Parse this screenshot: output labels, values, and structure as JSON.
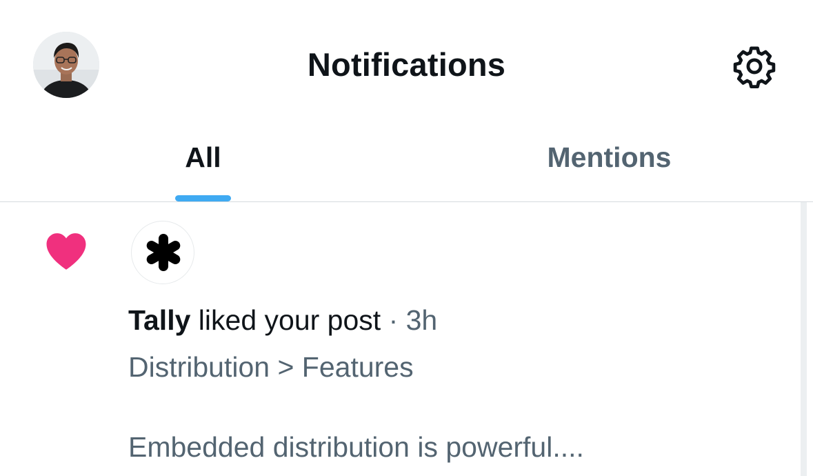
{
  "header": {
    "title": "Notifications",
    "avatar_icon": "profile-avatar",
    "settings_icon": "gear-icon"
  },
  "tabs": [
    {
      "label": "All",
      "selected": true
    },
    {
      "label": "Mentions",
      "selected": false
    }
  ],
  "colors": {
    "accent": "#1d9bf0",
    "like": "#f0307e",
    "text_primary": "#0f1419",
    "text_secondary": "#536471"
  },
  "notifications": [
    {
      "type_icon": "heart-icon",
      "actor_avatar_icon": "asterisk-icon",
      "actor": "Tally",
      "action": "liked your post",
      "separator": "·",
      "time": "3h",
      "context": "Distribution > Features",
      "preview": "Embedded distribution is powerful...."
    }
  ]
}
